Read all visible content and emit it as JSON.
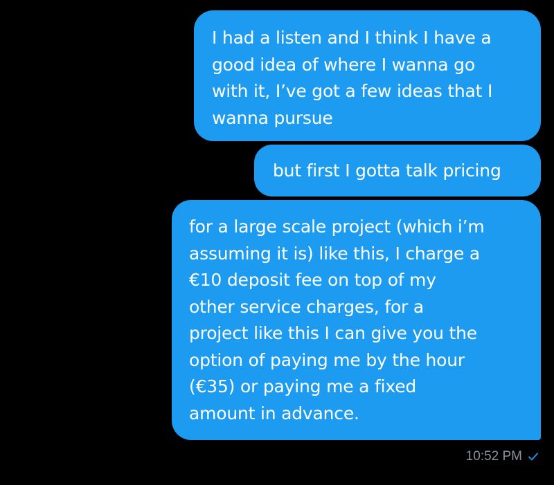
{
  "messages": [
    {
      "lines": [
        "I had a listen and I think I have a",
        "good idea of where I wanna go",
        "with it, I’ve got a few ideas that I",
        "wanna pursue"
      ]
    },
    {
      "lines": [
        "but first I gotta talk pricing"
      ]
    },
    {
      "lines": [
        "for a large scale project (which i’m",
        "assuming it is) like this, I charge a",
        "€10 deposit fee on top of my",
        "other service charges, for a",
        "project like this I can give you the",
        "option of paying me by the hour",
        "(€35) or paying me a fixed",
        "amount in advance."
      ]
    }
  ],
  "meta": {
    "timestamp": "10:52 PM",
    "status_icon": "checkmark-icon"
  },
  "colors": {
    "background": "#000000",
    "bubble": "#1d9bf0",
    "bubble_text": "#ffffff",
    "timestamp": "#8b949e",
    "check": "#1d9bf0"
  }
}
